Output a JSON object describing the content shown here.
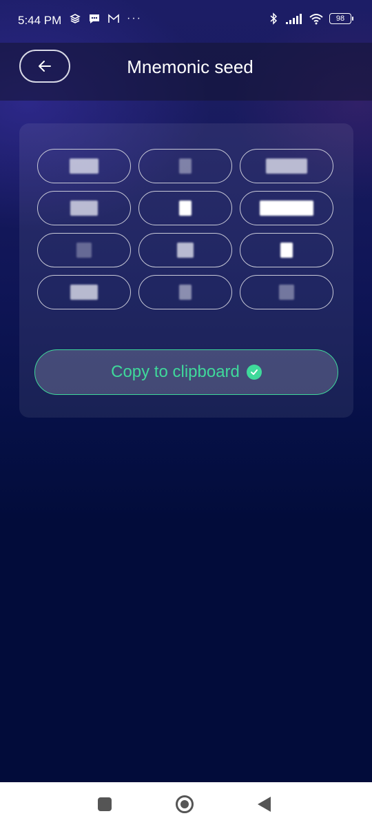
{
  "status_bar": {
    "time": "5:44 PM",
    "dots": "···",
    "battery": "98",
    "icons": [
      "layers-icon",
      "message-icon",
      "gmail-icon",
      "bluetooth-icon",
      "signal-icon",
      "wifi-icon",
      "battery-icon"
    ]
  },
  "header": {
    "title": "Mnemonic seed",
    "back_icon": "arrow-left-icon"
  },
  "seed": {
    "words": [
      "",
      "",
      "",
      "",
      "",
      "",
      "",
      "",
      "",
      "",
      "",
      ""
    ]
  },
  "copy": {
    "label": "Copy to clipboard",
    "icon": "check-circle-icon"
  },
  "colors": {
    "accent": "#3fd99b",
    "background": "#020c3a"
  }
}
